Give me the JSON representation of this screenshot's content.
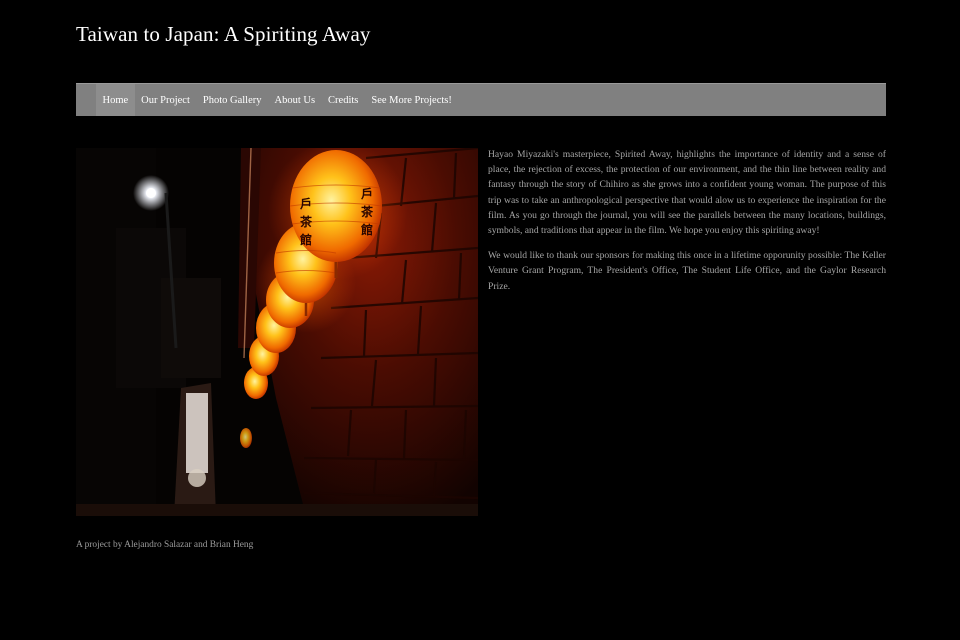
{
  "site": {
    "title": "Taiwan to Japan: A Spiriting Away"
  },
  "nav": {
    "items": [
      {
        "label": "Home",
        "active": true
      },
      {
        "label": "Our Project",
        "active": false
      },
      {
        "label": "Photo Gallery",
        "active": false
      },
      {
        "label": "About Us",
        "active": false
      },
      {
        "label": "Credits",
        "active": false
      },
      {
        "label": "See More Projects!",
        "active": false
      }
    ]
  },
  "hero": {
    "lantern_characters": [
      "戶",
      "茶",
      "館"
    ]
  },
  "content": {
    "paragraphs": [
      "Hayao Miyazaki's masterpiece, Spirited Away, highlights the importance of identity and a sense of place, the rejection of excess, the protection of our environment, and the thin line between reality and fantasy through the story of Chihiro as she grows into a confident young woman. The purpose of this trip was to take an anthropological perspective that would alow us to experience the inspiration for the film. As you go through the journal, you will see the parallels between the many locations, buildings, symbols, and traditions that appear in the film. We hope you enjoy this spiriting away!",
      "We would like to thank our sponsors for making this once in a lifetime opporunity possible: The Keller Venture Grant Program, The President's Office, The Student Life Office, and the Gaylor Research Prize."
    ]
  },
  "footer": {
    "credit": "A project by Alejandro Salazar and Brian Heng"
  },
  "colors": {
    "background": "#000000",
    "nav_bar": "#808080",
    "nav_active": "#8d8d8d",
    "title_text": "#ffffff",
    "body_text": "#a6a6a6",
    "lantern_glow": "#ff8a00"
  }
}
